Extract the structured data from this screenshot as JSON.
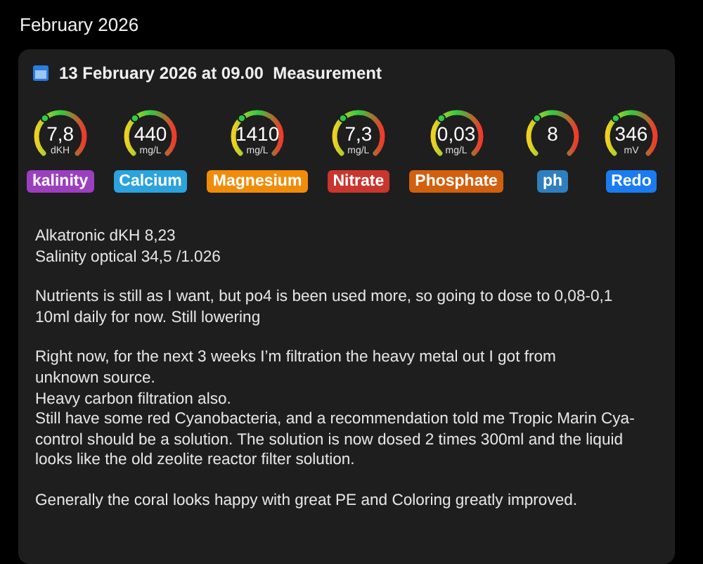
{
  "month_title": "February 2026",
  "entry": {
    "title": "13 February 2026 at 09.00  Measurement",
    "gauges": [
      {
        "value": "7,8",
        "unit": "dKH",
        "label": "kalinity",
        "color": "#9b3fbf"
      },
      {
        "value": "440",
        "unit": "mg/L",
        "label": "Calcium",
        "color": "#2ba3dc"
      },
      {
        "value": "1410",
        "unit": "mg/L",
        "label": "Magnesium",
        "color": "#f08c0a"
      },
      {
        "value": "7,3",
        "unit": "mg/L",
        "label": "Nitrate",
        "color": "#c8362e"
      },
      {
        "value": "0,03",
        "unit": "mg/L",
        "label": "Phosphate",
        "color": "#d2600e"
      },
      {
        "value": "8",
        "label": "ph",
        "color": "#2f7fbf"
      },
      {
        "value": "346",
        "unit": "mV",
        "label": "Redo",
        "color": "#1a7cf0"
      }
    ],
    "paragraphs": [
      [
        "Alkatronic dKH 8,23",
        "Salinity optical 34,5 /1.026"
      ],
      [
        "Nutrients is still as I want, but po4 is been used more, so going to dose to 0,08-0,1",
        "10ml daily for now. Still lowering"
      ],
      [
        "Right now, for the next 3 weeks I’m filtration the heavy metal out I got from",
        "unknown source.",
        "Heavy carbon filtration also.",
        "Still have some red Cyanobacteria, and a recommendation told me Tropic Marin Cya-",
        "control should be a solution. The solution is now dosed 2 times 300ml and the liquid",
        "looks like the old zeolite reactor filter solution."
      ],
      [
        "Generally the coral looks happy with great PE and Coloring greatly improved."
      ]
    ]
  }
}
